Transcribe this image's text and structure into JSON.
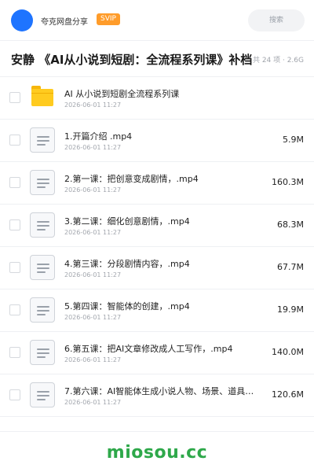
{
  "header": {
    "user_name": "夸克网盘分享",
    "badge": "SVIP",
    "search_placeholder": "搜索"
  },
  "title_row": {
    "title": "安静 《AI从小说到短剧：全流程系列课》补档",
    "summary": "共 24 项 · 2.6G"
  },
  "files": [
    {
      "name": "AI 从小说到短剧全流程系列课",
      "date": "2026-06-01 11:27",
      "size": "",
      "type": "folder"
    },
    {
      "name": "1.开篇介绍 .mp4",
      "date": "2026-06-01 11:27",
      "size": "5.9M",
      "type": "file"
    },
    {
      "name": "2.第一课：把创意变成剧情，.mp4",
      "date": "2026-06-01 11:27",
      "size": "160.3M",
      "type": "file"
    },
    {
      "name": "3.第二课：细化创意剧情，.mp4",
      "date": "2026-06-01 11:27",
      "size": "68.3M",
      "type": "file"
    },
    {
      "name": "4.第三课：分段剧情内容，.mp4",
      "date": "2026-06-01 11:27",
      "size": "67.7M",
      "type": "file"
    },
    {
      "name": "5.第四课：智能体的创建，.mp4",
      "date": "2026-06-01 11:27",
      "size": "19.9M",
      "type": "file"
    },
    {
      "name": "6.第五课：把AI文章修改成人工写作，.mp4",
      "date": "2026-06-01 11:27",
      "size": "140.0M",
      "type": "file"
    },
    {
      "name": "7.第六课：AI智能体生成小说人物、场景、道具，…",
      "date": "2026-06-01 11:27",
      "size": "120.6M",
      "type": "file"
    }
  ],
  "footer": {
    "watermark": "miosou.cc"
  },
  "colors": {
    "avatar": "#1e74ff",
    "badge": "#ff9c2a",
    "folder": "#ffcb1f",
    "watermark": "#2ea84a"
  }
}
